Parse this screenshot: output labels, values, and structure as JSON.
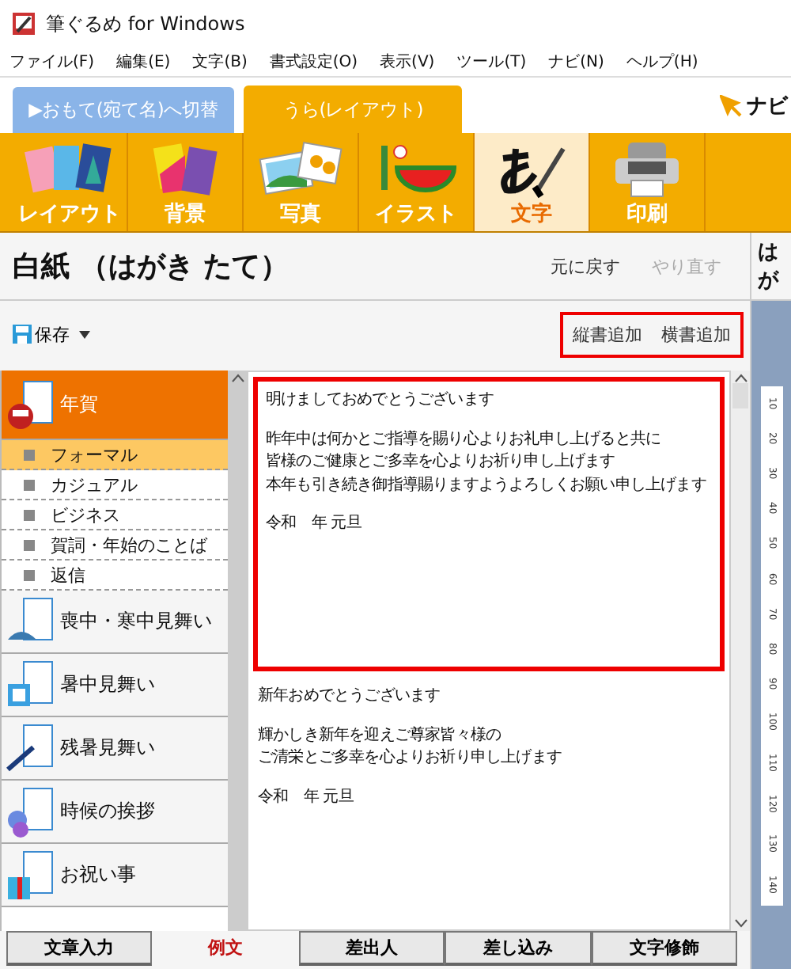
{
  "window": {
    "title": "筆ぐるめ for Windows"
  },
  "menu": [
    "ファイル(F)",
    "編集(E)",
    "文字(B)",
    "書式設定(O)",
    "表示(V)",
    "ツール(T)",
    "ナビ(N)",
    "ヘルプ(H)"
  ],
  "side_tabs": [
    {
      "label": "▶おもて(宛て名)へ切替",
      "selected": false
    },
    {
      "label": "うら(レイアウト)",
      "selected": true
    }
  ],
  "navi_label": "ナビ",
  "ribbon": [
    {
      "kind": "cards",
      "label": "レイアウト",
      "selected": false
    },
    {
      "kind": "background",
      "label": "背景",
      "selected": false
    },
    {
      "kind": "photo",
      "label": "写真",
      "selected": false
    },
    {
      "kind": "illust",
      "label": "イラスト",
      "selected": false
    },
    {
      "kind": "text",
      "label": "文字",
      "selected": true
    },
    {
      "kind": "printer",
      "label": "印刷",
      "selected": false
    }
  ],
  "panel": {
    "title": "白紙 （はがき たて）",
    "undo": {
      "label": "元に戻す",
      "disabled": false
    },
    "redo": {
      "label": "やり直す",
      "disabled": true
    },
    "save_label": "保存",
    "add_buttons": [
      "縦書追加",
      "横書追加"
    ]
  },
  "categories": [
    {
      "kind": "newyear",
      "label": "年賀",
      "selected": true,
      "expanded": true,
      "children": [
        {
          "label": "フォーマル",
          "selected": true
        },
        {
          "label": "カジュアル",
          "selected": false
        },
        {
          "label": "ビジネス",
          "selected": false
        },
        {
          "label": "賀詞・年始のことば",
          "selected": false
        },
        {
          "label": "返信",
          "selected": false
        }
      ]
    },
    {
      "kind": "mourning",
      "label": "喪中・寒中見舞い",
      "selected": false
    },
    {
      "kind": "summer",
      "label": "暑中見舞い",
      "selected": false
    },
    {
      "kind": "latesummer",
      "label": "残暑見舞い",
      "selected": false
    },
    {
      "kind": "season",
      "label": "時候の挨拶",
      "selected": false
    },
    {
      "kind": "gift",
      "label": "お祝い事",
      "selected": false
    }
  ],
  "samples": [
    {
      "selected": true,
      "paragraphs": [
        [
          "明けましておめでとうございます"
        ],
        [
          "昨年中は何かとご指導を賜り心よりお礼申し上げると共に",
          "皆様のご健康とご多幸を心よりお祈り申し上げます",
          "本年も引き続き御指導賜りますようよろしくお願い申し上げます"
        ],
        [
          "令和　年 元旦"
        ]
      ]
    },
    {
      "selected": false,
      "paragraphs": [
        [
          "新年おめでとうございます"
        ],
        [
          "輝かしき新年を迎えご尊家皆々様の",
          "ご清栄とご多幸を心よりお祈り申し上げます"
        ],
        [
          "令和　年 元旦"
        ]
      ]
    }
  ],
  "preview": {
    "title": "はが",
    "ruler_labels": [
      "10",
      "20",
      "30",
      "40",
      "50",
      "60",
      "70",
      "80",
      "90",
      "100",
      "110",
      "120",
      "130",
      "140"
    ]
  },
  "bottom_tabs": [
    {
      "label": "文章入力",
      "selected": false
    },
    {
      "label": "例文",
      "selected": true
    },
    {
      "label": "差出人",
      "selected": false
    },
    {
      "label": "差し込み",
      "selected": false
    },
    {
      "label": "文字修飾",
      "selected": false
    }
  ]
}
